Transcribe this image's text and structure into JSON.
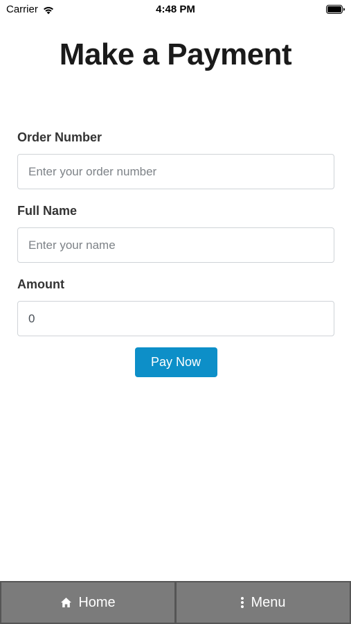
{
  "status_bar": {
    "carrier": "Carrier",
    "time": "4:48 PM"
  },
  "page": {
    "title": "Make a Payment"
  },
  "form": {
    "order_number": {
      "label": "Order Number",
      "placeholder": "Enter your order number",
      "value": ""
    },
    "full_name": {
      "label": "Full Name",
      "placeholder": "Enter your name",
      "value": ""
    },
    "amount": {
      "label": "Amount",
      "placeholder": "",
      "value": "0"
    },
    "submit_label": "Pay Now"
  },
  "bottom_nav": {
    "items": [
      {
        "label": "Home",
        "icon": "home-icon"
      },
      {
        "label": "Menu",
        "icon": "vertical-dots-icon"
      }
    ]
  },
  "colors": {
    "accent": "#0d8fc8",
    "nav_background": "#7b7b7b",
    "title_text": "#1a1a1a"
  }
}
